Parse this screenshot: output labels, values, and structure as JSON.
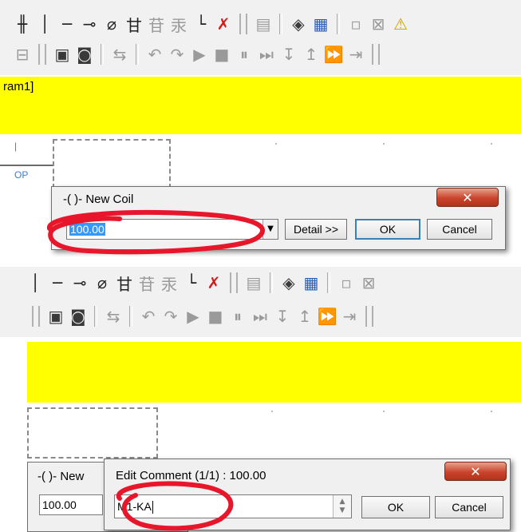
{
  "colors": {
    "rung_yellow": "#ffff00",
    "annotation_red": "#e8162a",
    "close_red": "#c9442b",
    "selection_blue": "#3399ff"
  },
  "toolbar_top": {
    "row1_icons": [
      "parallel-contact-icon",
      "vertical-line-icon",
      "horizontal-line-icon",
      "coil-icon",
      "negated-coil-icon",
      "set-icon",
      "reset-icon",
      "function-icon",
      "end-line-icon",
      "delete-line-icon",
      "rung-comment-icon",
      "compile-icon",
      "device-icon",
      "label-icon",
      "label-cross-icon",
      "label-cond-icon"
    ],
    "row2_icons": [
      "monitor-icon",
      "write-icon",
      "read-icon",
      "transfer-icon",
      "undo-icon",
      "redo-icon",
      "run-icon",
      "stop-icon",
      "pause-icon",
      "step-icon",
      "step-in-icon",
      "step-out-icon",
      "fast-forward-icon",
      "end-icon"
    ]
  },
  "panel1": {
    "program_label": "ram1]",
    "left_fragment_1": "|",
    "left_fragment_2": "OP",
    "new_coil_dialog": {
      "title": "-( )- New Coil",
      "close_glyph": "✕",
      "value": "100.00",
      "dropdown_glyph": "▼",
      "detail_button": "Detail >>",
      "ok_button": "OK",
      "cancel_button": "Cancel"
    }
  },
  "panel2": {
    "behind_dialog": {
      "title": "-( )- New",
      "value": "100.00"
    },
    "edit_comment_dialog": {
      "title": "Edit Comment (1/1) : 100.00",
      "close_glyph": "✕",
      "value": "M1-KA",
      "spin_up": "▲",
      "spin_down": "▼",
      "ok_button": "OK",
      "cancel_button": "Cancel"
    }
  }
}
